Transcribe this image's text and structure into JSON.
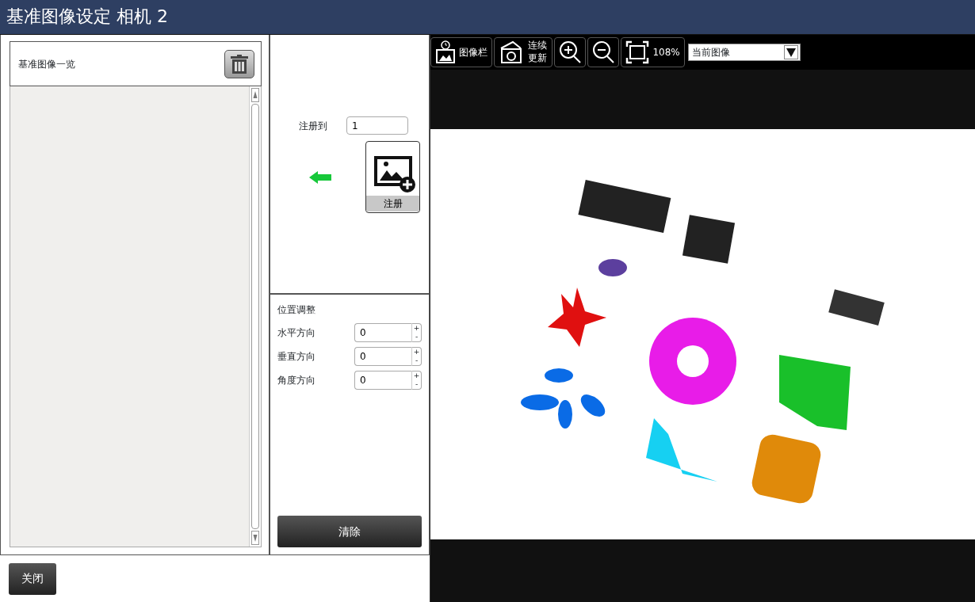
{
  "window": {
    "title": "基准图像设定 相机 2"
  },
  "image_list": {
    "title": "基准图像一览"
  },
  "register": {
    "label": "注册到",
    "value": "1",
    "button": "注册"
  },
  "position": {
    "title": "位置调整",
    "fields": [
      {
        "label": "水平方向",
        "value": "0",
        "up": "+",
        "down": "-"
      },
      {
        "label": "垂直方向",
        "value": "0",
        "up": "+",
        "down": "-"
      },
      {
        "label": "角度方向",
        "value": "0",
        "up": "+",
        "down": "-"
      }
    ]
  },
  "clear_button": "清除",
  "close_button": "关闭",
  "toolbar": {
    "gallery": "图像栏",
    "continuous": "连续更新",
    "zoom": "108%",
    "source": "当前图像"
  }
}
